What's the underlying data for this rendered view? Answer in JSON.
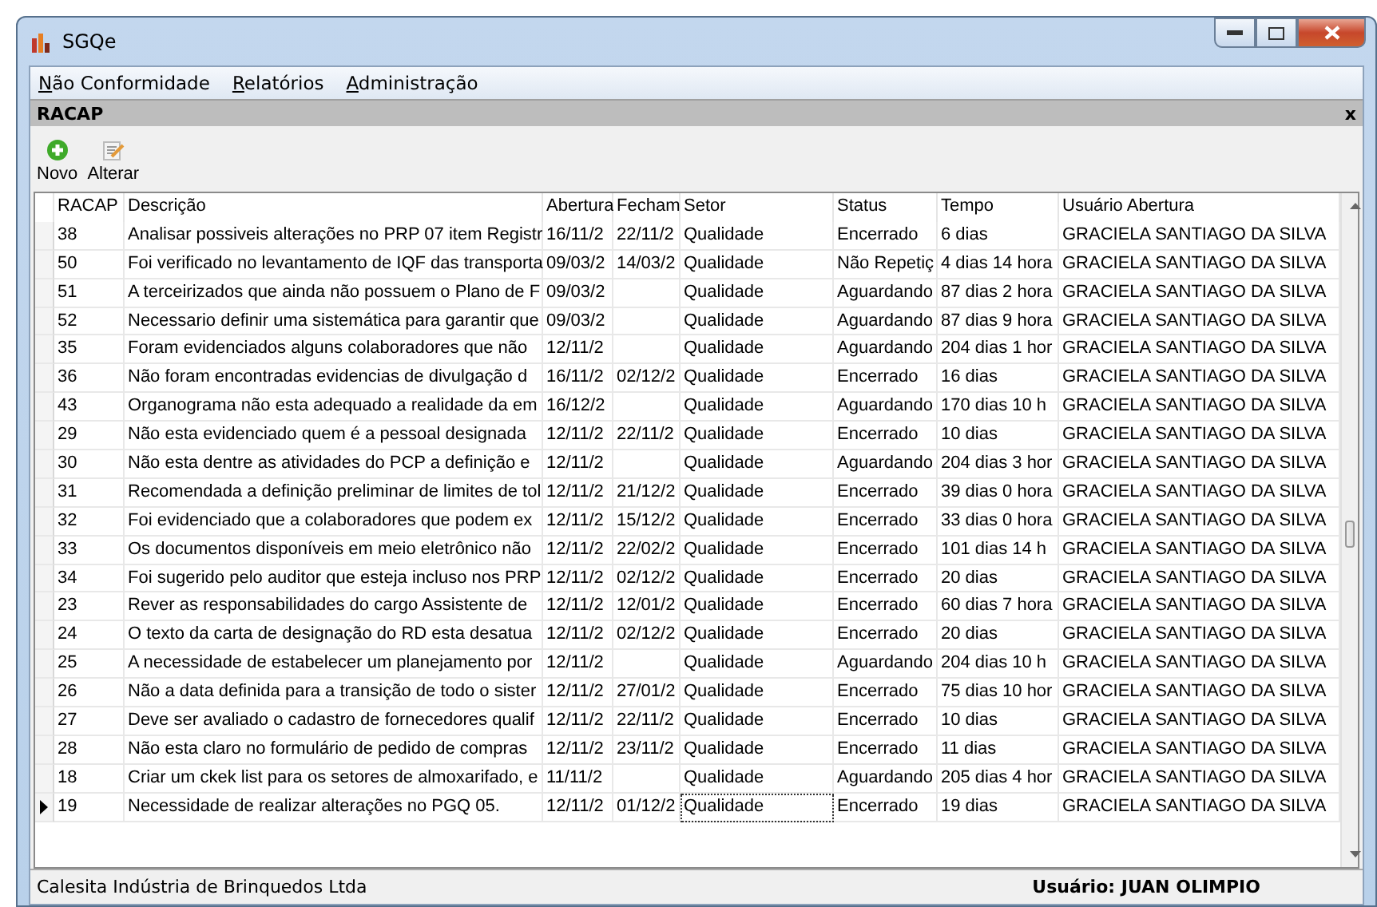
{
  "window": {
    "title": "SGQe"
  },
  "menu": [
    {
      "label": "Não Conformidade",
      "underlined_first": true
    },
    {
      "label": "Relatórios",
      "underlined_first": true
    },
    {
      "label": "Administração",
      "underlined_first": true
    }
  ],
  "panel": {
    "title": "RACAP",
    "close": "x"
  },
  "toolbar": [
    {
      "label": "Novo",
      "kind": "add"
    },
    {
      "label": "Alterar",
      "kind": "edit"
    }
  ],
  "table": {
    "columns": [
      "RACAP",
      "Descrição",
      "Abertura",
      "Fecham",
      "Setor",
      "Status",
      "Tempo",
      "Usuário Abertura"
    ],
    "rows": [
      {
        "selected": false,
        "cells": [
          "38",
          "Analisar possiveis alterações no PRP 07 item Registr",
          "16/11/2",
          "22/11/2",
          "Qualidade",
          "Encerrado",
          "6 dias",
          "GRACIELA SANTIAGO DA SILVA"
        ]
      },
      {
        "selected": false,
        "cells": [
          "50",
          "Foi verificado no levantamento de IQF das transporta",
          "09/03/2",
          "14/03/2",
          "Qualidade",
          "Não Repetiç",
          "4 dias 14 hora",
          "GRACIELA SANTIAGO DA SILVA"
        ]
      },
      {
        "selected": false,
        "cells": [
          "51",
          "A terceirizados que ainda não possuem o Plano de F",
          "09/03/2",
          "",
          "Qualidade",
          "Aguardando",
          "87 dias 2 hora",
          "GRACIELA SANTIAGO DA SILVA"
        ]
      },
      {
        "selected": false,
        "cells": [
          "52",
          "Necessario definir uma sistemática para garantir que",
          "09/03/2",
          "",
          "Qualidade",
          "Aguardando",
          "87 dias 9 hora",
          "GRACIELA SANTIAGO DA SILVA"
        ]
      },
      {
        "selected": false,
        "cells": [
          "35",
          "Foram evidenciados alguns colaboradores que não",
          "12/11/2",
          "",
          "Qualidade",
          "Aguardando",
          "204 dias 1 hor",
          "GRACIELA SANTIAGO DA SILVA"
        ]
      },
      {
        "selected": false,
        "cells": [
          "36",
          "Não foram encontradas evidencias de divulgação d",
          "16/11/2",
          "02/12/2",
          "Qualidade",
          "Encerrado",
          "16 dias",
          "GRACIELA SANTIAGO DA SILVA"
        ]
      },
      {
        "selected": false,
        "cells": [
          "43",
          "Organograma não esta adequado a realidade da em",
          "16/12/2",
          "",
          "Qualidade",
          "Aguardando",
          "170 dias 10 h",
          "GRACIELA SANTIAGO DA SILVA"
        ]
      },
      {
        "selected": false,
        "cells": [
          "29",
          "Não esta evidenciado quem é a pessoal designada",
          "12/11/2",
          "22/11/2",
          "Qualidade",
          "Encerrado",
          "10 dias",
          "GRACIELA SANTIAGO DA SILVA"
        ]
      },
      {
        "selected": false,
        "cells": [
          "30",
          "Não esta dentre as atividades do PCP a definição e",
          "12/11/2",
          "",
          "Qualidade",
          "Aguardando",
          "204 dias 3 hor",
          "GRACIELA SANTIAGO DA SILVA"
        ]
      },
      {
        "selected": false,
        "cells": [
          "31",
          "Recomendada a definição preliminar de limites de tol",
          "12/11/2",
          "21/12/2",
          "Qualidade",
          "Encerrado",
          "39 dias 0 hora",
          "GRACIELA SANTIAGO DA SILVA"
        ]
      },
      {
        "selected": false,
        "cells": [
          "32",
          "Foi evidenciado que a colaboradores que podem ex",
          "12/11/2",
          "15/12/2",
          "Qualidade",
          "Encerrado",
          "33 dias 0 hora",
          "GRACIELA SANTIAGO DA SILVA"
        ]
      },
      {
        "selected": false,
        "cells": [
          "33",
          "Os documentos disponíveis em meio eletrônico não",
          "12/11/2",
          "22/02/2",
          "Qualidade",
          "Encerrado",
          "101 dias 14 h",
          "GRACIELA SANTIAGO DA SILVA"
        ]
      },
      {
        "selected": false,
        "cells": [
          "34",
          "Foi sugerido pelo auditor que esteja incluso nos PRP",
          "12/11/2",
          "02/12/2",
          "Qualidade",
          "Encerrado",
          "20 dias",
          "GRACIELA SANTIAGO DA SILVA"
        ]
      },
      {
        "selected": false,
        "cells": [
          "23",
          "Rever as responsabilidades do cargo Assistente de",
          "12/11/2",
          "12/01/2",
          "Qualidade",
          "Encerrado",
          "60 dias 7 hora",
          "GRACIELA SANTIAGO DA SILVA"
        ]
      },
      {
        "selected": false,
        "cells": [
          "24",
          "O texto da carta de designação do RD esta desatua",
          "12/11/2",
          "02/12/2",
          "Qualidade",
          "Encerrado",
          "20 dias",
          "GRACIELA SANTIAGO DA SILVA"
        ]
      },
      {
        "selected": false,
        "cells": [
          "25",
          "A necessidade de estabelecer um planejamento por",
          "12/11/2",
          "",
          "Qualidade",
          "Aguardando",
          "204 dias 10 h",
          "GRACIELA SANTIAGO DA SILVA"
        ]
      },
      {
        "selected": false,
        "cells": [
          "26",
          "Não a data definida para a transição de todo o sister",
          "12/11/2",
          "27/01/2",
          "Qualidade",
          "Encerrado",
          "75 dias 10 hor",
          "GRACIELA SANTIAGO DA SILVA"
        ]
      },
      {
        "selected": false,
        "cells": [
          "27",
          "Deve ser avaliado o cadastro de fornecedores qualif",
          "12/11/2",
          "22/11/2",
          "Qualidade",
          "Encerrado",
          "10 dias",
          "GRACIELA SANTIAGO DA SILVA"
        ]
      },
      {
        "selected": false,
        "cells": [
          "28",
          "Não esta claro no formulário de pedido de compras",
          "12/11/2",
          "23/11/2",
          "Qualidade",
          "Encerrado",
          "11 dias",
          "GRACIELA SANTIAGO DA SILVA"
        ]
      },
      {
        "selected": false,
        "cells": [
          "18",
          "Criar um ckek list para os setores de almoxarifado, e",
          "11/11/2",
          "",
          "Qualidade",
          "Aguardando",
          "205 dias 4 hor",
          "GRACIELA SANTIAGO DA SILVA"
        ]
      },
      {
        "selected": true,
        "cells": [
          "19",
          "Necessidade de realizar alterações no PGQ 05.",
          "12/11/2",
          "01/12/2",
          "Qualidade",
          "Encerrado",
          "19 dias",
          "GRACIELA SANTIAGO DA SILVA"
        ]
      }
    ]
  },
  "status_bar": [
    "Calesita Indústria de Brinquedos Ltda",
    "Usuário: JUAN OLIMPIO"
  ]
}
